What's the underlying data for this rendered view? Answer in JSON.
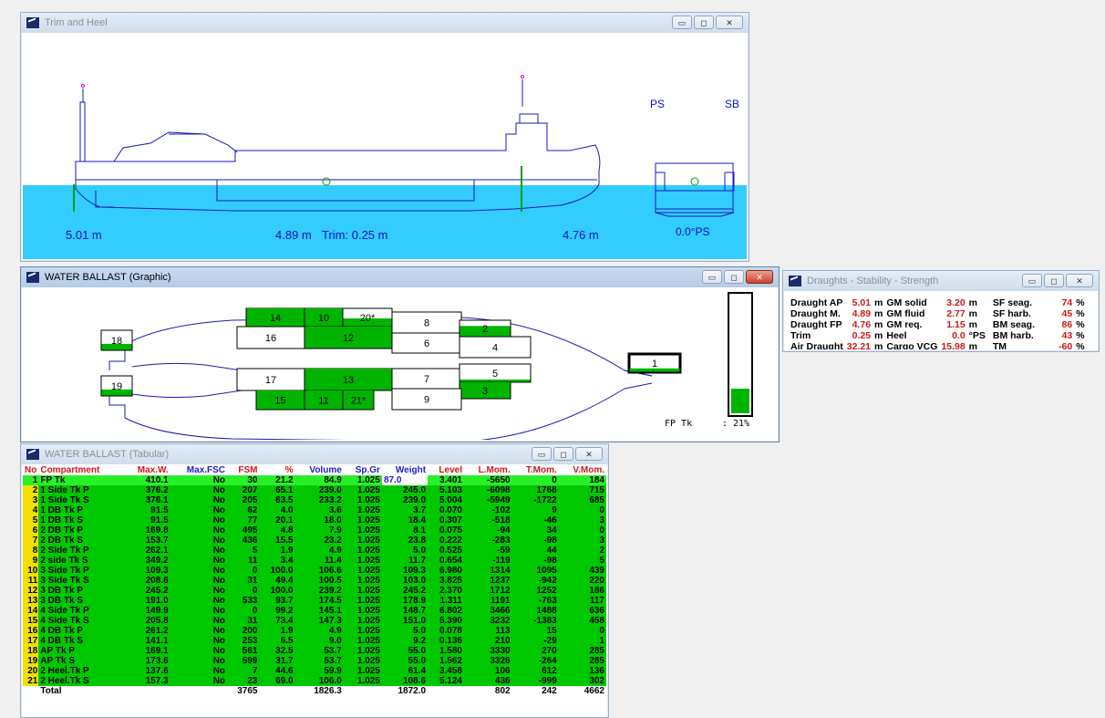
{
  "trim_window": {
    "title": "Trim and Heel",
    "ps_label": "PS",
    "sb_label": "SB",
    "draught_aft": "5.01 m",
    "draught_mid": "4.89 m",
    "trim_text": "Trim: 0.25 m",
    "draught_fwd": "4.76 m",
    "heel_text": "0.0°PS"
  },
  "graphic_window": {
    "title": "WATER BALLAST  (Graphic)",
    "selected_tank_label": "FP Tk",
    "selected_tank_pct": ": 21%",
    "selected_tank_fill": 0.21,
    "tanks": [
      {
        "label": "14",
        "fill": 1.0
      },
      {
        "label": "10",
        "fill": 1.0
      },
      {
        "label": "20*",
        "fill": 0.45
      },
      {
        "label": "8",
        "fill": 0.0
      },
      {
        "label": "16",
        "fill": 0.0
      },
      {
        "label": "12",
        "fill": 1.0
      },
      {
        "label": "6",
        "fill": 0.0
      },
      {
        "label": "2",
        "fill": 0.65
      },
      {
        "label": "4",
        "fill": 0.0
      },
      {
        "label": "18",
        "fill": 0.32
      },
      {
        "label": "19",
        "fill": 0.32
      },
      {
        "label": "17",
        "fill": 0.0
      },
      {
        "label": "13",
        "fill": 1.0
      },
      {
        "label": "7",
        "fill": 0.0
      },
      {
        "label": "5",
        "fill": 0.15
      },
      {
        "label": "3",
        "fill": 1.0
      },
      {
        "label": "15",
        "fill": 1.0
      },
      {
        "label": "11",
        "fill": 1.0
      },
      {
        "label": "21*",
        "fill": 1.0
      },
      {
        "label": "9",
        "fill": 0.0
      },
      {
        "label": "1",
        "fill": 0.21
      }
    ]
  },
  "draughts_window": {
    "title": "Draughts - Stability - Strength",
    "rows": [
      {
        "l1": "Draught AP",
        "v1": "5.01",
        "u1": "m",
        "l2": "GM solid",
        "v2": "3.20",
        "u2": "m",
        "l3": "SF seag.",
        "v3": "74",
        "u3": "%"
      },
      {
        "l1": "Draught M.",
        "v1": "4.89",
        "u1": "m",
        "l2": "GM fluid",
        "v2": "2.77",
        "u2": "m",
        "l3": "SF harb.",
        "v3": "45",
        "u3": "%"
      },
      {
        "l1": "Draught FP",
        "v1": "4.76",
        "u1": "m",
        "l2": "GM req.",
        "v2": "1.15",
        "u2": "m",
        "l3": "BM seag.",
        "v3": "86",
        "u3": "%"
      },
      {
        "l1": "Trim",
        "v1": "0.25",
        "u1": "m",
        "l2": "Heel",
        "v2": "0.0",
        "u2": "°PS",
        "l3": "BM harb.",
        "v3": "43",
        "u3": "%"
      },
      {
        "l1": "Air Draught",
        "v1": "32.21",
        "u1": "m",
        "l2": "Cargo VCG",
        "v2": "15.98",
        "u2": "m",
        "l3": "TM",
        "v3": "-60",
        "u3": "%"
      }
    ]
  },
  "tabular_window": {
    "title": "WATER BALLAST  (Tabular)",
    "headers": [
      "No",
      "Compartment",
      "Max.W.",
      "Max.FSC",
      "FSM",
      "%",
      "Volume",
      "Sp.Gr",
      "Weight",
      "Level",
      "L.Mom.",
      "T.Mom.",
      "V.Mom."
    ],
    "rows": [
      [
        "1",
        "FP Tk",
        "410.1",
        "No",
        "30",
        "21.2",
        "84.9",
        "1.025",
        "87.0",
        "3.401",
        "-5650",
        "0",
        "184"
      ],
      [
        "2",
        "1 Side Tk P",
        "376.2",
        "No",
        "207",
        "65.1",
        "239.0",
        "1.025",
        "245.0",
        "5.103",
        "-6098",
        "1768",
        "715"
      ],
      [
        "3",
        "1 Side Tk S",
        "376.1",
        "No",
        "205",
        "63.5",
        "233.2",
        "1.025",
        "239.0",
        "5.004",
        "-5949",
        "-1722",
        "685"
      ],
      [
        "4",
        "1 DB Tk P",
        "91.5",
        "No",
        "62",
        "4.0",
        "3.6",
        "1.025",
        "3.7",
        "0.070",
        "-102",
        "9",
        "0"
      ],
      [
        "5",
        "1 DB Tk S",
        "91.5",
        "No",
        "77",
        "20.1",
        "18.0",
        "1.025",
        "18.4",
        "0.307",
        "-518",
        "-46",
        "3"
      ],
      [
        "6",
        "2 DB Tk P",
        "169.8",
        "No",
        "495",
        "4.8",
        "7.9",
        "1.025",
        "8.1",
        "0.075",
        "-94",
        "34",
        "0"
      ],
      [
        "7",
        "2 DB Tk S",
        "153.7",
        "No",
        "436",
        "15.5",
        "23.2",
        "1.025",
        "23.8",
        "0.222",
        "-283",
        "-98",
        "3"
      ],
      [
        "8",
        "2 Side Tk P",
        "262.1",
        "No",
        "5",
        "1.9",
        "4.9",
        "1.025",
        "5.0",
        "0.525",
        "-59",
        "44",
        "2"
      ],
      [
        "9",
        "2 side Tk S",
        "349.2",
        "No",
        "11",
        "3.4",
        "11.4",
        "1.025",
        "11.7",
        "0.654",
        "-119",
        "-98",
        "5"
      ],
      [
        "10",
        "3 Side Tk P",
        "109.3",
        "No",
        "0",
        "100.0",
        "106.6",
        "1.025",
        "109.3",
        "6.980",
        "1314",
        "1095",
        "439"
      ],
      [
        "11",
        "3 Side Tk S",
        "208.6",
        "No",
        "31",
        "49.4",
        "100.5",
        "1.025",
        "103.0",
        "3.825",
        "1237",
        "-942",
        "220"
      ],
      [
        "12",
        "3 DB Tk P",
        "245.2",
        "No",
        "0",
        "100.0",
        "239.2",
        "1.025",
        "245.2",
        "2.370",
        "1712",
        "1252",
        "186"
      ],
      [
        "13",
        "3 DB Tk S",
        "191.0",
        "No",
        "533",
        "93.7",
        "174.5",
        "1.025",
        "178.9",
        "1.311",
        "1191",
        "-763",
        "117"
      ],
      [
        "14",
        "4 Side Tk P",
        "149.9",
        "No",
        "0",
        "99.2",
        "145.1",
        "1.025",
        "148.7",
        "6.802",
        "3466",
        "1488",
        "636"
      ],
      [
        "15",
        "4 Side Tk S",
        "205.8",
        "No",
        "31",
        "73.4",
        "147.3",
        "1.025",
        "151.0",
        "5.390",
        "3232",
        "-1383",
        "458"
      ],
      [
        "16",
        "4 DB Tk P",
        "261.2",
        "No",
        "200",
        "1.9",
        "4.9",
        "1.025",
        "5.0",
        "0.078",
        "113",
        "15",
        "0"
      ],
      [
        "17",
        "4 DB Tk S",
        "141.1",
        "No",
        "253",
        "6.5",
        "9.0",
        "1.025",
        "9.2",
        "0.136",
        "210",
        "-29",
        "1"
      ],
      [
        "18",
        "AP Tk P",
        "169.1",
        "No",
        "561",
        "32.5",
        "53.7",
        "1.025",
        "55.0",
        "1.580",
        "3330",
        "270",
        "285"
      ],
      [
        "19",
        "AP Tk S",
        "173.6",
        "No",
        "599",
        "31.7",
        "53.7",
        "1.025",
        "55.0",
        "1.562",
        "3326",
        "-264",
        "285"
      ],
      [
        "20",
        "2 Heel.Tk P",
        "137.6",
        "No",
        "7",
        "44.6",
        "59.9",
        "1.025",
        "61.4",
        "3.458",
        "106",
        "612",
        "136"
      ],
      [
        "21",
        "2 Heel.Tk S",
        "157.3",
        "No",
        "23",
        "69.0",
        "106.0",
        "1.025",
        "108.6",
        "5.124",
        "436",
        "-999",
        "302"
      ]
    ],
    "total": [
      "",
      "Total",
      "",
      "",
      "3765",
      "",
      "1826.3",
      "",
      "1872.0",
      "",
      "802",
      "242",
      "4662"
    ]
  }
}
